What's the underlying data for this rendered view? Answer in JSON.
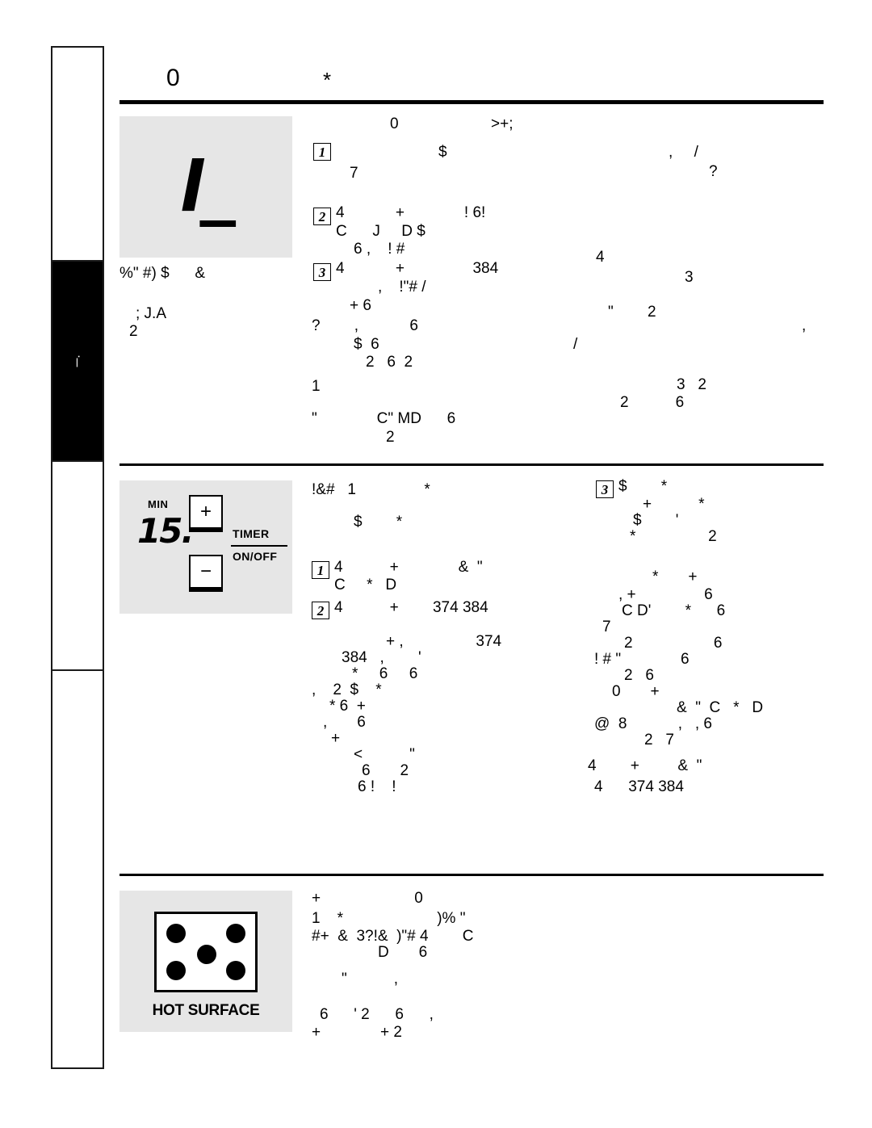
{
  "document": {
    "header": {
      "left_glyphs": "0",
      "right_glyphs": "*"
    }
  },
  "sidebar": {
    "tabs": [
      {
        "name": "tab-1",
        "label": "",
        "active": false
      },
      {
        "name": "tab-2-active",
        "label": "—.",
        "active": true
      },
      {
        "name": "tab-3",
        "label": "",
        "active": false
      },
      {
        "name": "tab-4",
        "label": "",
        "active": false
      }
    ]
  },
  "sections": [
    {
      "id": "section-lcd",
      "figure": {
        "type": "lcd-display",
        "digits": "l_",
        "caption_lines": [
          "%\" #) $      &",
          "; J.A",
          "2"
        ]
      },
      "heading": {
        "left": "0",
        "right": ">+;"
      },
      "steps": [
        {
          "num": "1",
          "lines": [
            "$",
            "7"
          ]
        },
        {
          "num": "2",
          "lines": [
            "4            +              ! 6!",
            "C      J     D $",
            "6 ,    ! #"
          ]
        },
        {
          "num": "3",
          "lines": [
            "4            +                384",
            ",    !\"# /",
            "+ 6"
          ]
        }
      ],
      "body_left": [
        "?        ,            6",
        "$  6",
        "2   6  2",
        "1",
        "\"              C\" MD      6",
        "2"
      ],
      "body_right": [
        ",     /",
        "?",
        "4",
        "3",
        "\"        2",
        ",",
        "/",
        "3   2",
        "2           6"
      ]
    },
    {
      "id": "section-timer",
      "figure": {
        "type": "timer-control",
        "min_label": "MIN",
        "digits": "15.",
        "plus_label": "+",
        "minus_label": "−",
        "timer_label": "TIMER",
        "onoff_label": "ON/OFF"
      },
      "heading_left": [
        "!&#   1                *",
        "$        *"
      ],
      "steps_left": [
        {
          "num": "1",
          "lines": [
            "4           +              &  \"",
            "C     *   D"
          ]
        },
        {
          "num": "2",
          "lines": [
            "4           +        374 384"
          ]
        }
      ],
      "steps_right": [
        {
          "num": "3",
          "lines": [
            "$        *",
            "+           *",
            "$        '",
            "*                 2"
          ]
        }
      ],
      "body_left": [
        "+ ,                 374",
        "384   ,        '",
        "*     6     6",
        ",    2  $    *",
        "* 6  +",
        ",       6",
        "+",
        "<           \"",
        "6       2",
        "6 !    !"
      ],
      "body_right": [
        "*       +",
        ", +                6",
        "C D'        *      6",
        "7",
        "2                   6",
        "! # \"              6",
        "2   6",
        "0       +",
        "&  \"  C   *   D",
        "@  8            ,   , 6",
        "2   7",
        "4        +         &  \"",
        "4      374 384"
      ]
    },
    {
      "id": "section-hot-surface",
      "figure": {
        "type": "hot-surface-indicator",
        "label": "HOT SURFACE",
        "burner_count": 5
      },
      "body": [
        "+                      0",
        "1    *                      )% \"",
        "#+  &  3?!&  )\"# 4        C",
        "D       6",
        "\"           ,",
        "6      ' 2      6      ,",
        "+              + 2"
      ]
    }
  ],
  "colors": {
    "ink": "#000000",
    "figure_background": "#e6e6e6",
    "page_background": "#ffffff"
  }
}
